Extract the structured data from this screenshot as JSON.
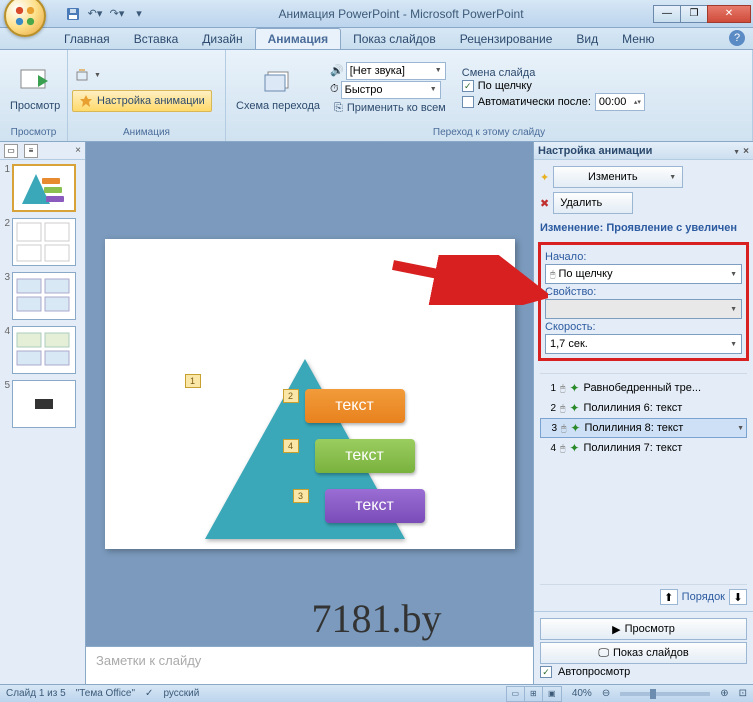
{
  "title": "Анимация PowerPoint - Microsoft PowerPoint",
  "tabs": {
    "home": "Главная",
    "insert": "Вставка",
    "design": "Дизайн",
    "animation": "Анимация",
    "slideshow": "Показ слайдов",
    "review": "Рецензирование",
    "view": "Вид",
    "menu": "Меню"
  },
  "ribbon": {
    "preview": {
      "btn": "Просмотр",
      "group": "Просмотр"
    },
    "anim": {
      "customize": "Настройка анимации",
      "group": "Анимация"
    },
    "transition": {
      "scheme": "Схема перехода",
      "sound_label": "[Нет звука]",
      "speed_label": "Быстро",
      "apply_all": "Применить ко всем",
      "group": "Переход к этому слайду",
      "advance_title": "Смена слайда",
      "on_click": "По щелчку",
      "auto_after": "Автоматически после:",
      "auto_time": "00:00"
    }
  },
  "thumbs": {
    "count": 5,
    "selected": 1
  },
  "slide": {
    "box1": "текст",
    "box2": "текст",
    "box3": "текст",
    "tag1": "1",
    "tag2": "2",
    "tag3": "3",
    "tag4": "4"
  },
  "watermark": "7181.by",
  "notes_placeholder": "Заметки к слайду",
  "taskpane": {
    "title": "Настройка анимации",
    "change_btn": "Изменить",
    "delete_btn": "Удалить",
    "change_header": "Изменение: Проявление с увеличен",
    "start_label": "Начало:",
    "start_value": "По щелчку",
    "property_label": "Свойство:",
    "speed_label": "Скорость:",
    "speed_value": "1,7 сек.",
    "items": [
      {
        "n": "1",
        "text": "Равнобедренный тре..."
      },
      {
        "n": "2",
        "text": "Полилиния 6: текст"
      },
      {
        "n": "3",
        "text": "Полилиния 8: текст"
      },
      {
        "n": "4",
        "text": "Полилиния 7: текст"
      }
    ],
    "selected_item": 2,
    "reorder": "Порядок",
    "preview": "Просмотр",
    "slideshow": "Показ слайдов",
    "autopreview": "Автопросмотр"
  },
  "status": {
    "slide": "Слайд 1 из 5",
    "theme": "\"Тема Office\"",
    "lang": "русский",
    "zoom": "40%"
  }
}
